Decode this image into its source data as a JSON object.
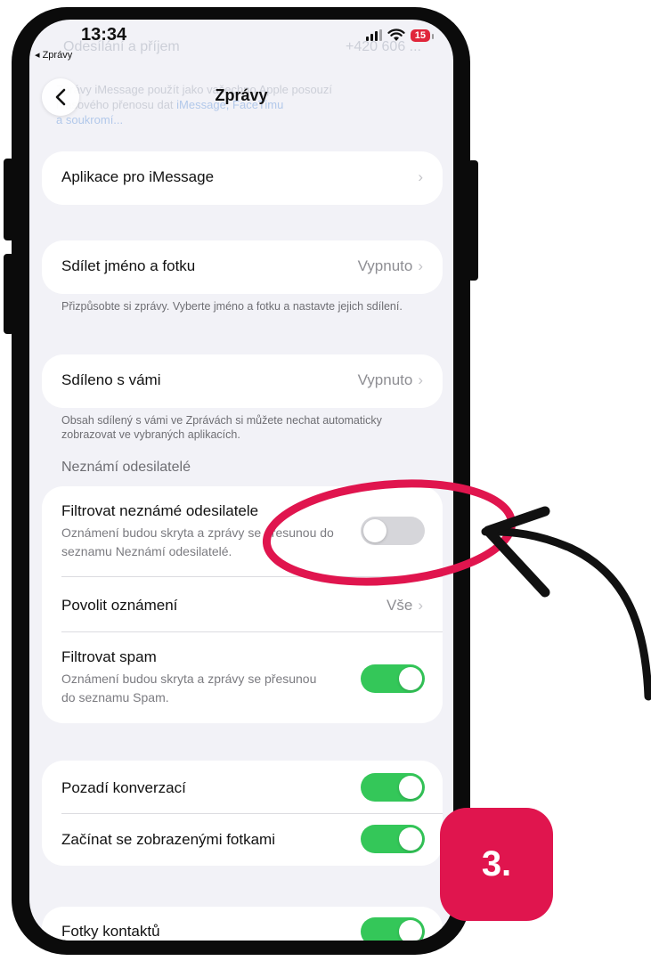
{
  "status": {
    "time": "13:34",
    "back_app": "Zprávy",
    "battery": "15"
  },
  "background_text": {
    "line1": "Odesílání a příjem",
    "line1_value": "+420 606 ...",
    "line2": "Zprávy iMessage použít jako vašechno Apple posouzí",
    "line3_prefix": "hlasového přenosu dat ",
    "line3_link": "iMessage, FaceTimu",
    "line4_link": "a soukromí..."
  },
  "nav": {
    "title": "Zprávy"
  },
  "rows": {
    "apps": {
      "label": "Aplikace pro iMessage"
    },
    "share_name": {
      "label": "Sdílet jméno a fotku",
      "value": "Vypnuto",
      "footnote": "Přizpůsobte si zprávy. Vyberte jméno a fotku a nastavte jejich sdílení."
    },
    "shared_with_you": {
      "label": "Sdíleno s vámi",
      "value": "Vypnuto",
      "footnote": "Obsah sdílený s vámi ve Zprávách si můžete nechat automaticky zobrazovat ve vybraných aplikacích."
    }
  },
  "unknown_senders": {
    "header": "Neznámí odesilatelé",
    "filter_unknown": {
      "label": "Filtrovat neznámé odesilatele",
      "sub": "Oznámení budou skryta a zprávy se přesunou do seznamu Neznámí odesilatelé.",
      "on": false
    },
    "allow_notifications": {
      "label": "Povolit oznámení",
      "value": "Vše"
    },
    "filter_spam": {
      "label": "Filtrovat spam",
      "sub": "Oznámení budou skryta a zprávy se přesunou do seznamu Spam.",
      "on": true
    }
  },
  "conversation": {
    "background": {
      "label": "Pozadí konverzací",
      "on": true
    },
    "start_with_photos": {
      "label": "Začínat se zobrazenými fotkami",
      "on": true
    }
  },
  "contacts": {
    "photos": {
      "label": "Fotky kontaktů",
      "on": true
    }
  },
  "annotation": {
    "step_number": "3.",
    "highlight_color": "#e0154e",
    "arrow_color": "#111111"
  },
  "colors": {
    "toggle_on": "#34c759",
    "toggle_off": "#d6d6da",
    "background": "#f2f2f7"
  }
}
